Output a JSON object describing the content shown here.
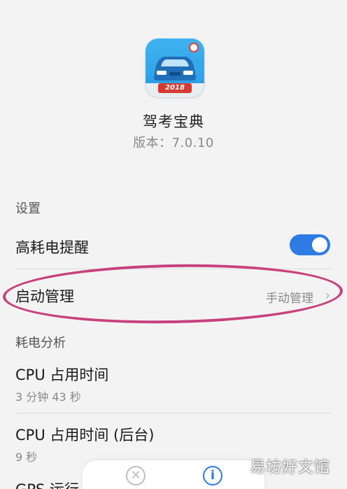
{
  "app": {
    "name": "驾考宝典",
    "version": "版本：7.0.10",
    "icon_year": "2018"
  },
  "settings": {
    "section_label": "设置",
    "high_power_alert": {
      "label": "高耗电提醒",
      "enabled": true
    },
    "launch_management": {
      "label": "启动管理",
      "value": "手动管理",
      "chevron": "›"
    }
  },
  "power_analysis": {
    "section_label": "耗电分析",
    "items": [
      {
        "label": "CPU 占用时间",
        "value": "3 分钟 43 秒"
      },
      {
        "label": "CPU 占用时间 (后台)",
        "value": "9 秒"
      },
      {
        "label": "GPS 运行"
      }
    ]
  },
  "bottom_bar": {
    "close_icon": "close-icon",
    "info_icon": "info-icon",
    "close_glyph": "✕",
    "info_glyph": "i"
  },
  "watermark": "易坊好文馆",
  "colors": {
    "accent_blue": "#2f7be6",
    "highlight_pink": "#c8417f"
  }
}
